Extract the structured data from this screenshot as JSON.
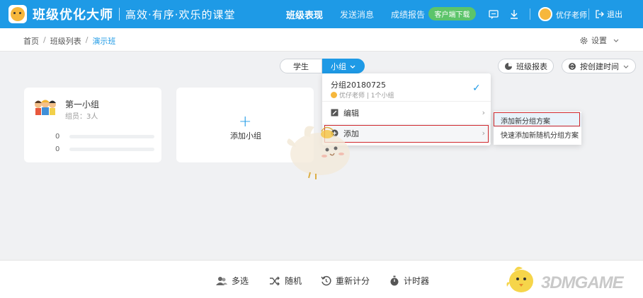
{
  "header": {
    "app_title": "班级优化大师",
    "slogan": "高效·有序·欢乐的课堂",
    "nav": [
      "班级表现",
      "发送消息",
      "成绩报告"
    ],
    "download_button": "客户端下载",
    "user_name": "优仔老师",
    "logout_label": "退出",
    "brand_color": "#1e9ae6"
  },
  "breadcrumb": {
    "items": [
      "首页",
      "班级列表",
      "演示班"
    ],
    "settings_label": "设置"
  },
  "view_tabs": {
    "students": "学生",
    "groups": "小组"
  },
  "actions": {
    "class_report": "班级报表",
    "sort_label": "按创建时间"
  },
  "group_card": {
    "name": "第一小组",
    "members": "组员：3人",
    "score_1": "0",
    "score_2": "0"
  },
  "add_group_label": "添加小组",
  "dropdown": {
    "scheme_name": "分组20180725",
    "scheme_sub": "优仔老师 | 1个小组",
    "edit_label": "编辑",
    "add_label": "添加"
  },
  "submenu": {
    "item_1": "添加新分组方案",
    "item_2": "快速添加新随机分组方案"
  },
  "toolbar": {
    "multi_select": "多选",
    "random": "随机",
    "rescore": "重新计分",
    "timer": "计时器"
  },
  "watermark_text": "3DMGAME"
}
